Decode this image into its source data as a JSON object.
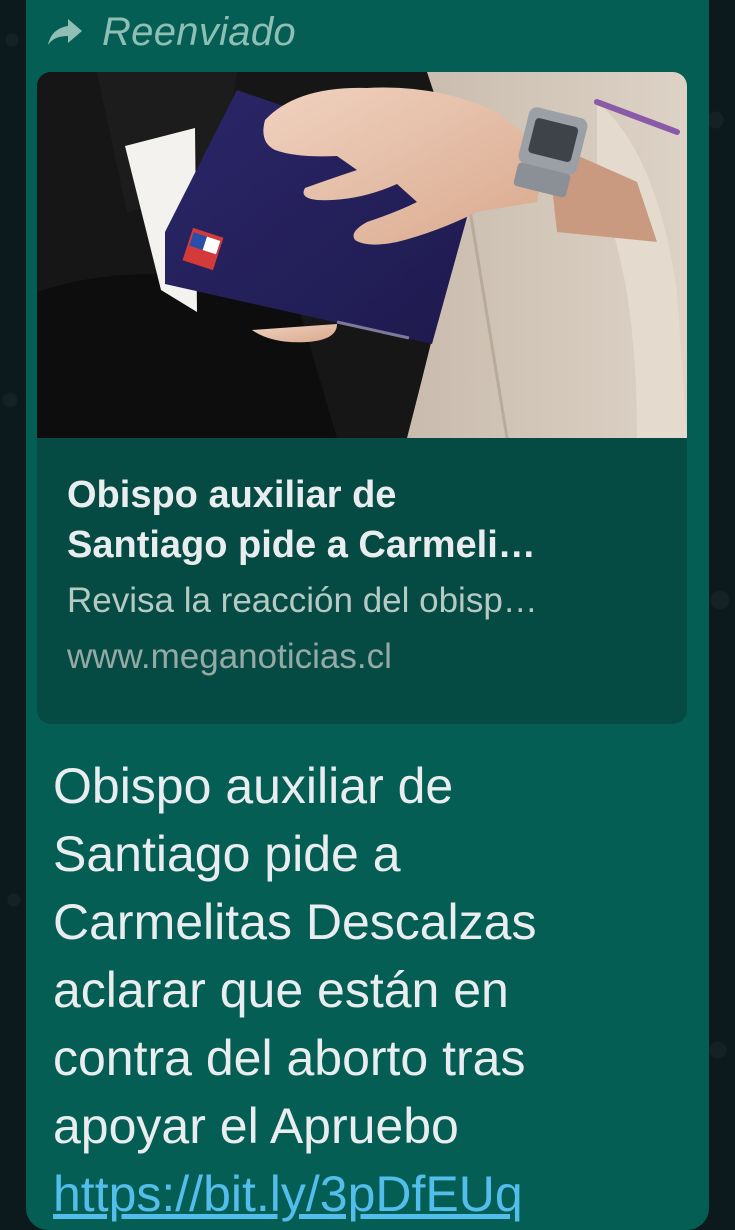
{
  "message": {
    "forwarded_label": "Reenviado",
    "link_preview": {
      "title_line1": "Obispo auxiliar de",
      "title_line2": "Santiago pide a Carmeli…",
      "description": "Revisa la reacción del obisp…",
      "domain": "www.meganoticias.cl"
    },
    "text_lines": [
      "Obispo auxiliar de",
      "Santiago pide a",
      "Carmelitas Descalzas",
      "aclarar que están en",
      "contra del aborto tras",
      "apoyar el Apruebo"
    ],
    "link_text": "https://bit.ly/3pDfEUq"
  },
  "colors": {
    "bubble": "#055e54",
    "preview_card": "#064b43",
    "link": "#53bdeb",
    "forwarded_text": "#8fbeb5"
  },
  "icons": {
    "forward": "forward-arrow-icon"
  }
}
